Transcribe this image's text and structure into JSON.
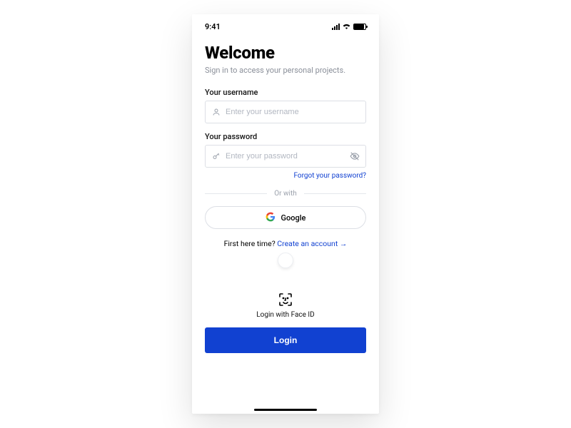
{
  "status": {
    "time": "9:41"
  },
  "header": {
    "title": "Welcome",
    "subtitle": "Sign in to access your personal projects."
  },
  "form": {
    "username_label": "Your username",
    "username_placeholder": "Enter your username",
    "password_label": "Your password",
    "password_placeholder": "Enter your password",
    "forgot": "Forgot your password?"
  },
  "divider": {
    "or": "Or with"
  },
  "google": {
    "label": "Google"
  },
  "signup": {
    "prompt": "First here time? ",
    "link": "Create an account →"
  },
  "faceid": {
    "label": "Login with Face ID"
  },
  "login": {
    "label": "Login"
  }
}
